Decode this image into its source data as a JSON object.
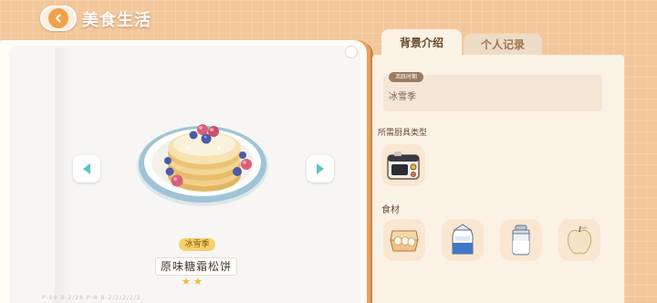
{
  "header": {
    "title": "美食生活"
  },
  "tabs": [
    {
      "label": "背景介绍",
      "active": true
    },
    {
      "label": "个人记录",
      "active": false
    }
  ],
  "book": {
    "season_tag": "冰雪季",
    "food_name": "原味糖霜松饼",
    "stars": "★★",
    "star_rating": 2,
    "footer": "P-59   B-2/28   P-8   B-2/2/2/2/2"
  },
  "panel": {
    "active_period_label": "活跃时期",
    "active_period_value": "冰雪季",
    "tool_section_label": "所需厨具类型",
    "tool_icon": "stove-icon",
    "ingredient_section_label": "食材",
    "ingredient_icons": [
      "egg-carton-icon",
      "milk-carton-icon",
      "sugar-jar-icon",
      "apple-icon"
    ]
  },
  "colors": {
    "background": "#f3c79a",
    "accent_orange": "#f0a24a",
    "season_tag": "#f4d16a",
    "star": "#f0b830",
    "nav_arrow": "#5bc4c2"
  }
}
